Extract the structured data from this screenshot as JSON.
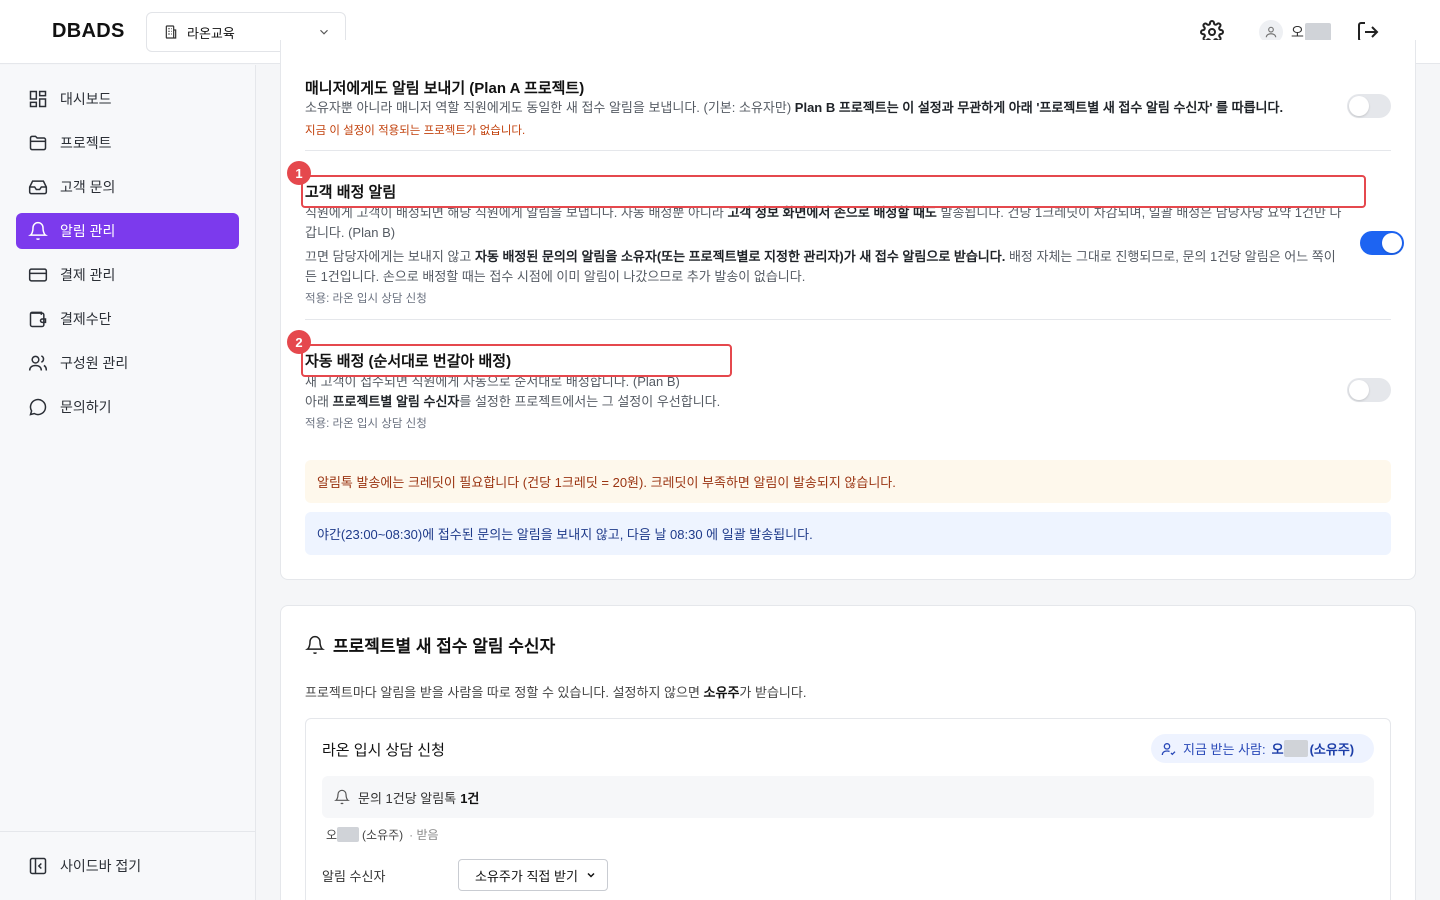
{
  "header": {
    "logo": "DBADS",
    "org_name": "라온교육",
    "user_name": "오"
  },
  "sidebar": {
    "items": [
      {
        "label": "대시보드",
        "icon": "dashboard-icon"
      },
      {
        "label": "프로젝트",
        "icon": "folder-icon"
      },
      {
        "label": "고객 문의",
        "icon": "inbox-icon"
      },
      {
        "label": "알림 관리",
        "icon": "bell-icon",
        "active": true
      },
      {
        "label": "결제 관리",
        "icon": "credit-card-icon"
      },
      {
        "label": "결제수단",
        "icon": "wallet-icon"
      },
      {
        "label": "구성원 관리",
        "icon": "users-icon"
      },
      {
        "label": "문의하기",
        "icon": "chat-icon"
      }
    ],
    "collapse_label": "사이드바 접기"
  },
  "settings": {
    "manager_alert": {
      "title": "매니저에게도 알림 보내기 (Plan A 프로젝트)",
      "desc_plain": "소유자뿐 아니라 매니저 역할 직원에게도 동일한 새 접수 알림을 보냅니다. (기본: 소유자만) ",
      "desc_bold": "Plan B 프로젝트는 이 설정과 무관하게 아래 '프로젝트별 새 접수 알림 수신자' 를 따릅니다.",
      "warning": "지금 이 설정이 적용되는 프로젝트가 없습니다.",
      "enabled": false
    },
    "assign_alert": {
      "number": "1",
      "title": "고객 배정 알림",
      "p1_a": "직원에게 고객이 배정되면 해당 직원에게 알림을 보냅니다. 자동 배정뿐 아니라 ",
      "p1_b": "고객 정보 화면에서 손으로 배정할 때도",
      "p1_c": " 발송됩니다. 건당 1크레딧이 차감되며, 일괄 배정은 담당자당 요약 1건만 나",
      "p1_d": "갑니다. (Plan B)",
      "p2_a": "끄면 담당자에게는 보내지 않고 ",
      "p2_b": "자동 배정된 문의의 알림을 소유자(또는 프로젝트별로 지정한 관리자)가 새 접수 알림으로 받습니다.",
      "p2_c": " 배정 자체는 그대로 진행되므로, 문의 1건당 알림은 어느 쪽이",
      "p2_d": "든 1건입니다. 손으로 배정할 때는 접수 시점에 이미 알림이 나갔으므로 추가 발송이 없습니다.",
      "applied": "적용: 라온 입시 상담 신청",
      "enabled": true
    },
    "auto_assign": {
      "number": "2",
      "title": "자동 배정 (순서대로 번갈아 배정)",
      "p1": "새 고객이 접수되면 직원에게 자동으로 순서대로 배정합니다. (Plan B)",
      "p2_a": "아래 ",
      "p2_b": "프로젝트별 알림 수신자",
      "p2_c": "를 설정한 프로젝트에서는 그 설정이 우선합니다.",
      "applied": "적용: 라온 입시 상담 신청",
      "enabled": false
    },
    "credit_notice": "알림톡 발송에는 크레딧이 필요합니다 (건당 1크레딧 = 20원). 크레딧이 부족하면 알림이 발송되지 않습니다.",
    "night_notice": "야간(23:00~08:30)에 접수된 문의는 알림을 보내지 않고, 다음 날 08:30 에 일괄 발송됩니다."
  },
  "recipients": {
    "title": "프로젝트별 새 접수 알림 수신자",
    "desc_a": "프로젝트마다 알림을 받을 사람을 따로 정할 수 있습니다. 설정하지 않으면 ",
    "desc_b": "소유주",
    "desc_c": "가 받습니다.",
    "project": {
      "name": "라온 입시 상담 신청",
      "current_label": "지금 받는 사람:",
      "current_name": "오",
      "current_role": "(소유주)",
      "count_label": "문의 1건당 알림톡",
      "count_value": "1건",
      "owner_name": "오",
      "owner_role": "(소유주)",
      "owner_tag": "· 받음",
      "field_label": "알림 수신자",
      "select_value": "소유주가 직접 받기"
    }
  },
  "colors": {
    "accent": "#7c3aed",
    "toggle_on": "#1d64f2",
    "highlight": "#e5484d",
    "warning": "#c2410c"
  }
}
